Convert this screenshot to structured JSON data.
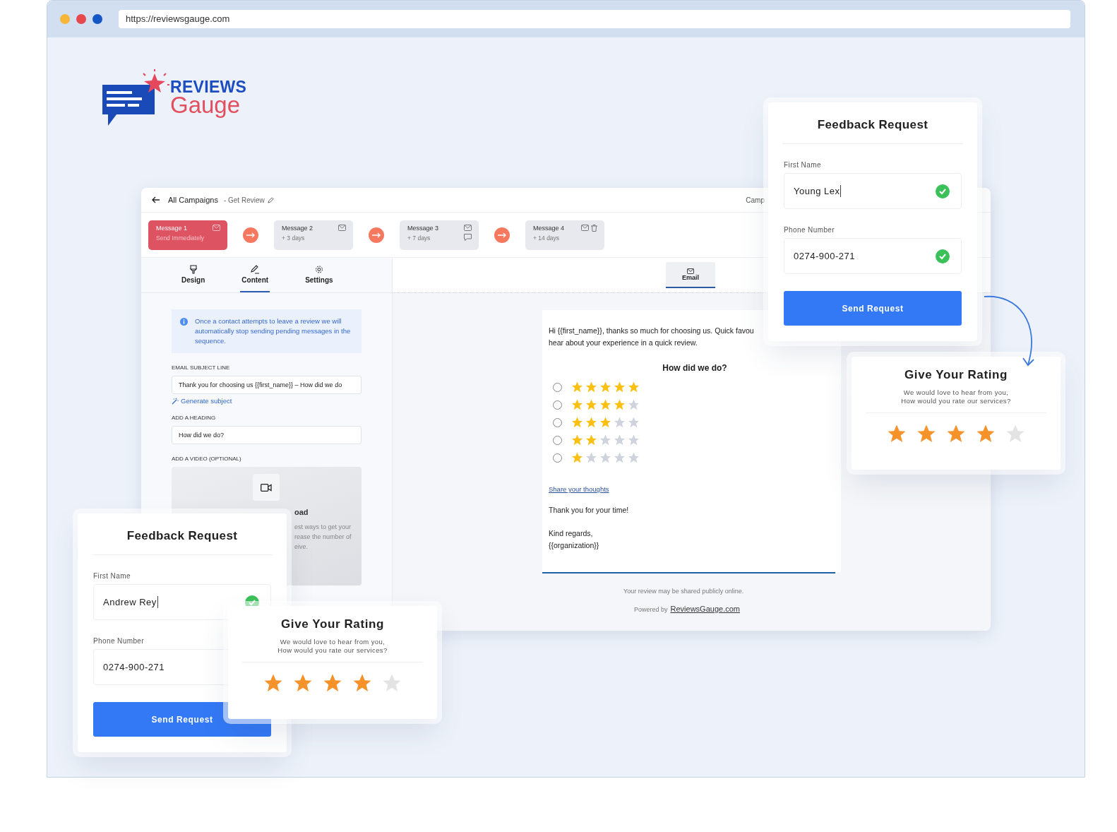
{
  "browser": {
    "url": "https://reviewsgauge.com"
  },
  "logo": {
    "line1": "REVIEWS",
    "line2": "Gauge"
  },
  "campaign": {
    "back_label": "All Campaigns",
    "name": "- Get Review",
    "right_button": "Camp"
  },
  "messages": [
    {
      "title": "Message 1",
      "delay": "Send Immediately",
      "selected": true,
      "icons": [
        {
          "kind": "mail"
        }
      ]
    },
    {
      "title": "Message 2",
      "delay": "+ 3 days",
      "selected": false,
      "icons": [
        {
          "kind": "mail"
        }
      ]
    },
    {
      "title": "Message 3",
      "delay": "+ 7 days",
      "selected": false,
      "icons": [
        {
          "kind": "mail"
        },
        {
          "kind": "chat"
        }
      ]
    },
    {
      "title": "Message 4",
      "delay": "+ 14 days",
      "selected": false,
      "icons": [
        {
          "kind": "mail"
        },
        {
          "kind": "trash"
        }
      ]
    }
  ],
  "editor_tabs": [
    {
      "label": "Design",
      "selected": false
    },
    {
      "label": "Content",
      "selected": true
    },
    {
      "label": "Settings",
      "selected": false
    }
  ],
  "info_note": "Once a contact attempts to leave a review we will automatically stop sending pending messages in the sequence.",
  "subject": {
    "label": "EMAIL SUBJECT LINE",
    "value": "Thank you for choosing us {{first_name}} – How did we do",
    "link": "Generate subject"
  },
  "heading": {
    "label": "ADD A HEADING",
    "value": "How did we do?"
  },
  "video": {
    "label": "ADD A VIDEO (OPTIONAL)",
    "title": "oad",
    "lines": [
      "est ways to get your",
      "rease the number of",
      "eive."
    ]
  },
  "preview_tab": {
    "label": "Email",
    "selected": true
  },
  "email": {
    "intro_lines": [
      "Hi {{first_name}}, thanks so much for choosing us. Quick favou",
      "hear about your experience in a quick review."
    ],
    "question": "How did we do?",
    "rating_options": [
      {
        "stars": 5,
        "selected": false
      },
      {
        "stars": 4,
        "selected": false
      },
      {
        "stars": 3,
        "selected": false
      },
      {
        "stars": 2,
        "selected": false
      },
      {
        "stars": 1,
        "selected": false
      }
    ],
    "link": "Share your thoughts",
    "thanks": "Thank you for your time!",
    "signoff": [
      "Kind regards,",
      "{{organization}}"
    ]
  },
  "footer": {
    "note": "Your review may be shared publicly online.",
    "powered_prefix": "Powered by",
    "powered_link": "ReviewsGauge.com"
  },
  "forms": [
    {
      "title": "Feedback Request",
      "fields": [
        {
          "label": "First Name",
          "value": "Young Lex",
          "valid": true,
          "focused": true
        },
        {
          "label": "Phone Number",
          "value": "0274-900-271",
          "valid": true,
          "focused": false
        }
      ],
      "button": "Send Request"
    },
    {
      "title": "Feedback Request",
      "fields": [
        {
          "label": "First Name",
          "value": "Andrew Rey",
          "valid": true,
          "focused": true
        },
        {
          "label": "Phone Number",
          "value": "0274-900-271",
          "focused": false
        }
      ],
      "button": "Send Request"
    }
  ],
  "ratings": [
    {
      "title": "Give Your Rating",
      "subtitle_lines": [
        "We would love to hear from you,",
        "How would you rate our services?"
      ],
      "stars": 4
    },
    {
      "title": "Give Your Rating",
      "subtitle_lines": [
        "We would love to hear from you,",
        "How would you rate our services?"
      ],
      "stars": 4
    }
  ]
}
